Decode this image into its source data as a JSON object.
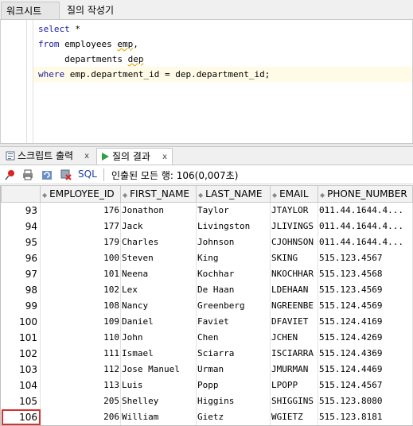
{
  "tabs": {
    "worksheet": "워크시트",
    "query_builder": "질의 작성기"
  },
  "editor": {
    "line1_kw": "select",
    "line1_rest": " *",
    "line2_kw": "from",
    "line2_table": " employees ",
    "line2_alias": "emp",
    "line2_comma": ",",
    "line3_table": "     departments ",
    "line3_alias": "dep",
    "line4_kw": "where",
    "line4_rest": " emp.department_id = dep.department_id;"
  },
  "output_tabs": {
    "script_output": "스크립트 출력",
    "query_result": "질의 결과",
    "close": "x"
  },
  "toolbar": {
    "sql_label": "SQL",
    "status": "인출된 모든 행: 106(0,007초)"
  },
  "grid": {
    "columns": [
      "EMPLOYEE_ID",
      "FIRST_NAME",
      "LAST_NAME",
      "EMAIL",
      "PHONE_NUMBER"
    ],
    "rows": [
      {
        "rn": "93",
        "id": "176",
        "first": "Jonathon",
        "last": "Taylor",
        "email": "JTAYLOR",
        "phone": "011.44.1644.4..."
      },
      {
        "rn": "94",
        "id": "177",
        "first": "Jack",
        "last": "Livingston",
        "email": "JLIVINGS",
        "phone": "011.44.1644.4..."
      },
      {
        "rn": "95",
        "id": "179",
        "first": "Charles",
        "last": "Johnson",
        "email": "CJOHNSON",
        "phone": "011.44.1644.4..."
      },
      {
        "rn": "96",
        "id": "100",
        "first": "Steven",
        "last": "King",
        "email": "SKING",
        "phone": "515.123.4567"
      },
      {
        "rn": "97",
        "id": "101",
        "first": "Neena",
        "last": "Kochhar",
        "email": "NKOCHHAR",
        "phone": "515.123.4568"
      },
      {
        "rn": "98",
        "id": "102",
        "first": "Lex",
        "last": "De Haan",
        "email": "LDEHAAN",
        "phone": "515.123.4569"
      },
      {
        "rn": "99",
        "id": "108",
        "first": "Nancy",
        "last": "Greenberg",
        "email": "NGREENBE",
        "phone": "515.124.4569"
      },
      {
        "rn": "100",
        "id": "109",
        "first": "Daniel",
        "last": "Faviet",
        "email": "DFAVIET",
        "phone": "515.124.4169"
      },
      {
        "rn": "101",
        "id": "110",
        "first": "John",
        "last": "Chen",
        "email": "JCHEN",
        "phone": "515.124.4269"
      },
      {
        "rn": "102",
        "id": "111",
        "first": "Ismael",
        "last": "Sciarra",
        "email": "ISCIARRA",
        "phone": "515.124.4369"
      },
      {
        "rn": "103",
        "id": "112",
        "first": "Jose Manuel",
        "last": "Urman",
        "email": "JMURMAN",
        "phone": "515.124.4469"
      },
      {
        "rn": "104",
        "id": "113",
        "first": "Luis",
        "last": "Popp",
        "email": "LPOPP",
        "phone": "515.124.4567"
      },
      {
        "rn": "105",
        "id": "205",
        "first": "Shelley",
        "last": "Higgins",
        "email": "SHIGGINS",
        "phone": "515.123.8080"
      },
      {
        "rn": "106",
        "id": "206",
        "first": "William",
        "last": "Gietz",
        "email": "WGIETZ",
        "phone": "515.123.8181"
      }
    ]
  }
}
